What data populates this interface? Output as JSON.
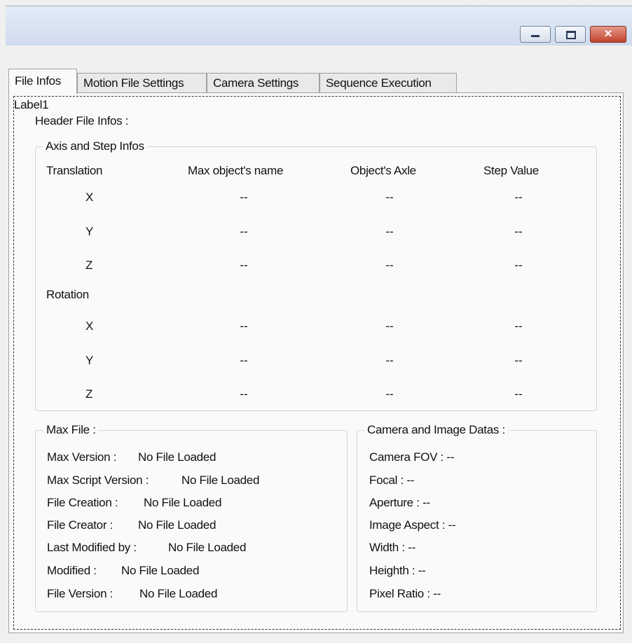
{
  "window": {
    "controls": {
      "minimize": "",
      "maximize": "",
      "close": "✕"
    }
  },
  "tabs": [
    "File Infos",
    "Motion File Settings",
    "Camera Settings",
    "Sequence Execution"
  ],
  "content": {
    "label1": "Label1",
    "header": "Header File Infos :",
    "axis_group": {
      "title": "Axis and Step Infos",
      "columns": [
        "Max object's name",
        "Object's Axle",
        "Step Value"
      ],
      "translation_label": "Translation",
      "rotation_label": "Rotation",
      "translation_rows": [
        {
          "axis": "X",
          "name": "--",
          "axle": "--",
          "step": "--"
        },
        {
          "axis": "Y",
          "name": "--",
          "axle": "--",
          "step": "--"
        },
        {
          "axis": "Z",
          "name": "--",
          "axle": "--",
          "step": "--"
        }
      ],
      "rotation_rows": [
        {
          "axis": "X",
          "name": "--",
          "axle": "--",
          "step": "--"
        },
        {
          "axis": "Y",
          "name": "--",
          "axle": "--",
          "step": "--"
        },
        {
          "axis": "Z",
          "name": "--",
          "axle": "--",
          "step": "--"
        }
      ]
    },
    "max_file": {
      "title": "Max File :",
      "rows": [
        {
          "label": "Max Version :",
          "value": "No File Loaded"
        },
        {
          "label": "Max Script Version :",
          "value": "No File Loaded"
        },
        {
          "label": "File Creation :",
          "value": "No File Loaded"
        },
        {
          "label": "File Creator :",
          "value": "No File Loaded"
        },
        {
          "label": "Last Modified by :",
          "value": "No File Loaded"
        },
        {
          "label": "Modified :",
          "value": "No File Loaded"
        },
        {
          "label": "File Version :",
          "value": "No File Loaded"
        }
      ]
    },
    "camera": {
      "title": "Camera and Image Datas :",
      "rows": [
        "Camera FOV : --",
        "Focal : --",
        "Aperture : --",
        "Image Aspect : --",
        "Width : --",
        "Heighth : --",
        "Pixel Ratio : --"
      ]
    }
  }
}
